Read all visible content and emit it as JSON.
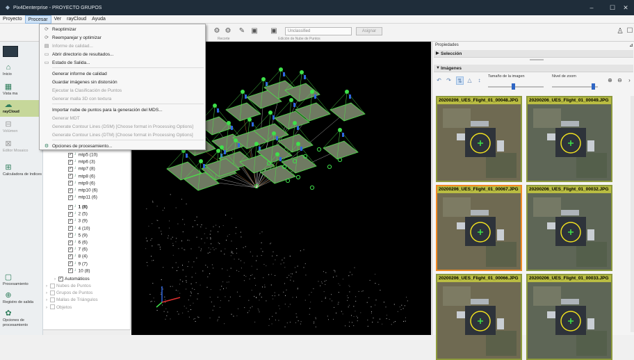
{
  "window": {
    "title": "Pix4Denterprise - PROYECTO GRUPOS"
  },
  "menu": [
    "Proyecto",
    "Procesar",
    "Ver",
    "rayCloud",
    "Ayuda"
  ],
  "procesar_menu": [
    {
      "label": "Reoptimizar",
      "disabled": false
    },
    {
      "label": "Reemparejar y optimizar",
      "disabled": false
    },
    {
      "label": "Informe de calidad...",
      "disabled": true
    },
    {
      "label": "Abrir directorio de resultados...",
      "disabled": false
    },
    {
      "label": "Estado de Salida...",
      "disabled": false
    },
    {
      "label": "Generar informe de calidad",
      "disabled": false
    },
    {
      "label": "Guardar imágenes sin distorsión",
      "disabled": false
    },
    {
      "label": "Ejecutar la Clasificación de Puntos",
      "disabled": true
    },
    {
      "label": "Generar malla 3D con textura",
      "disabled": true
    },
    {
      "label": "Importar nube de puntos para la generación del MDS...",
      "disabled": false
    },
    {
      "label": "Generar MDT",
      "disabled": true
    },
    {
      "label": "Generate Contour Lines (DSM) [Choose format in Processing Options]",
      "disabled": true
    },
    {
      "label": "Generate Contour Lines (DTM) [Choose format in Processing Options]",
      "disabled": true
    },
    {
      "label": "Opciones de procesamiento...",
      "disabled": false
    }
  ],
  "toolbar": {
    "class_select": "Unclassified",
    "assign_button": "Asignar",
    "recorte_label": "Recorte",
    "edicion_label": "Edición de Nube de Puntos"
  },
  "left_nav": [
    {
      "label": "Inicio",
      "icon": "home-icon"
    },
    {
      "label": "Mapa",
      "icon": "map-icon"
    },
    {
      "label": "Vista ma",
      "icon": "vista-icon"
    },
    {
      "label": "rayCloud",
      "icon": "raycloud-icon",
      "active": true
    },
    {
      "label": "Volúmen",
      "icon": "volume-icon"
    },
    {
      "label": "Editor Mosaico",
      "icon": "mosaic-icon"
    },
    {
      "label": "Calculadora de índices",
      "icon": "calculator-icon"
    },
    {
      "label": "Procesamiento",
      "icon": "processing-icon"
    },
    {
      "label": "Registro de salida",
      "icon": "log-icon"
    },
    {
      "label": "Opciones de procesamiento",
      "icon": "options-icon"
    }
  ],
  "tree": {
    "mtp_items": [
      "mtp5 (10)",
      "mtp6 (3)",
      "mtp7 (8)",
      "mtp8 (6)",
      "mtp9 (6)",
      "mtp10 (6)",
      "mtp11 (6)"
    ],
    "numbered_items": [
      "1 (8)",
      "2 (5)",
      "3 (9)",
      "4 (10)",
      "5 (9)",
      "6 (6)",
      "7 (6)",
      "8 (4)",
      "9 (7)",
      "10 (8)"
    ],
    "automaticos": "Automáticos",
    "groups": [
      "Nubes de Puntos",
      "Grupos de Puntos",
      "Mallas de Triángulos",
      "Objetos"
    ]
  },
  "properties": {
    "title": "Propiedades",
    "seleccion": "Selección",
    "imagenes": "Imágenes",
    "tamano_label": "Tamaño de la imagen",
    "zoom_label": "Nivel de zoom",
    "tamano_level": 0.45,
    "zoom_level": 0.9
  },
  "images": [
    "20200206_UES_Flight_01_00048.JPG",
    "20200206_UES_Flight_01_00049.JPG",
    "20200206_UES_Flight_01_00067.JPG",
    "20200206_UES_Flight_01_00032.JPG",
    "20200206_UES_Flight_01_00066.JPG",
    "20200206_UES_Flight_01_00033.JPG"
  ],
  "colors": {
    "accent_green": "#2e7d5b",
    "selected_border": "#f08a24",
    "thumb_title_bg": "#b9bc42"
  }
}
